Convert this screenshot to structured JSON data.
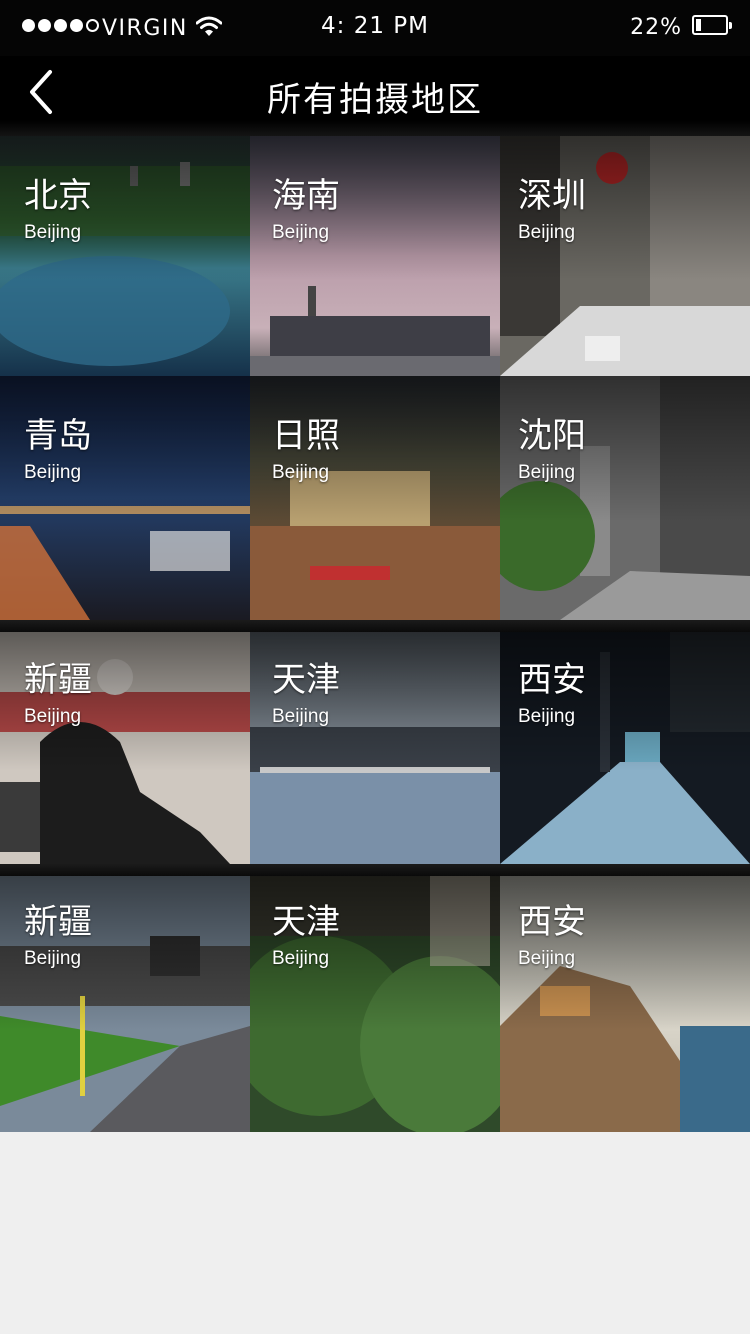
{
  "status_bar": {
    "carrier": "VIRGIN",
    "time": "4: 21 PM",
    "battery": "22%"
  },
  "nav": {
    "back_icon": "chevron-left-icon",
    "title": "所有拍摄地区"
  },
  "regions": [
    {
      "name": "北京",
      "sub": "Beijing"
    },
    {
      "name": "海南",
      "sub": "Beijing"
    },
    {
      "name": "深圳",
      "sub": "Beijing"
    },
    {
      "name": "青岛",
      "sub": "Beijing"
    },
    {
      "name": "日照",
      "sub": "Beijing"
    },
    {
      "name": "沈阳",
      "sub": "Beijing"
    },
    {
      "name": "新疆",
      "sub": "Beijing"
    },
    {
      "name": "天津",
      "sub": "Beijing"
    },
    {
      "name": "西安",
      "sub": "Beijing"
    },
    {
      "name": "新疆",
      "sub": "Beijing"
    },
    {
      "name": "天津",
      "sub": "Beijing"
    },
    {
      "name": "西安",
      "sub": "Beijing"
    }
  ]
}
